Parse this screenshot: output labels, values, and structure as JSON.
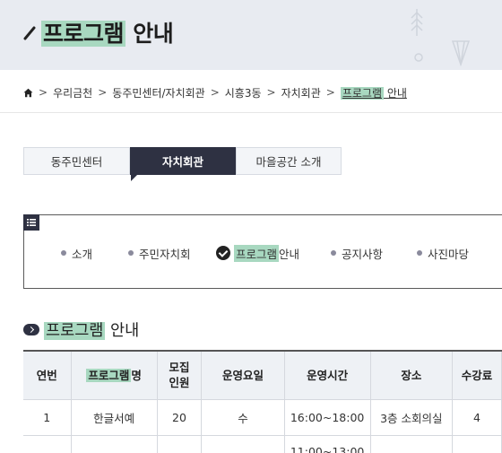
{
  "header": {
    "title_hl": "프로그램",
    "title_rest": " 안내",
    "pencil_icon": "pencil-icon",
    "deco_icon": "tree-decoration"
  },
  "breadcrumb": {
    "home_icon": "home-icon",
    "items": [
      "우리금천",
      "동주민센터/자치회관",
      "시흥3동",
      "자치회관"
    ],
    "current_hl": "프로그램",
    "current_rest": " 안내"
  },
  "tabs": [
    {
      "label": "동주민센터",
      "active": false
    },
    {
      "label": "자치회관",
      "active": true
    },
    {
      "label": "마을공간 소개",
      "active": false
    }
  ],
  "submenu": {
    "menu_icon": "menu-list-icon",
    "items": [
      {
        "label": "소개"
      },
      {
        "label": "주민자치회"
      },
      {
        "label_hl": "프로그램",
        "label_rest": " 안내",
        "active": true
      },
      {
        "label": "공지사항"
      },
      {
        "label": "사진마당"
      }
    ]
  },
  "section": {
    "title_hl": "프로그램",
    "title_rest": " 안내"
  },
  "table": {
    "headers": {
      "no": "연번",
      "name_hl": "프로그램",
      "name_rest": "명",
      "cap_line1": "모집",
      "cap_line2": "인원",
      "day": "운영요일",
      "time": "운영시간",
      "place": "장소",
      "fee": "수강료"
    },
    "rows": [
      {
        "no": "1",
        "name": "한글서예",
        "cap": "20",
        "day": "수",
        "time": "16:00~18:00",
        "place": "3층 소회의실",
        "fee": "4"
      },
      {
        "no": "",
        "name": "",
        "cap": "",
        "day": "",
        "time": "11:00~13:00",
        "place": "",
        "fee": ""
      }
    ]
  }
}
